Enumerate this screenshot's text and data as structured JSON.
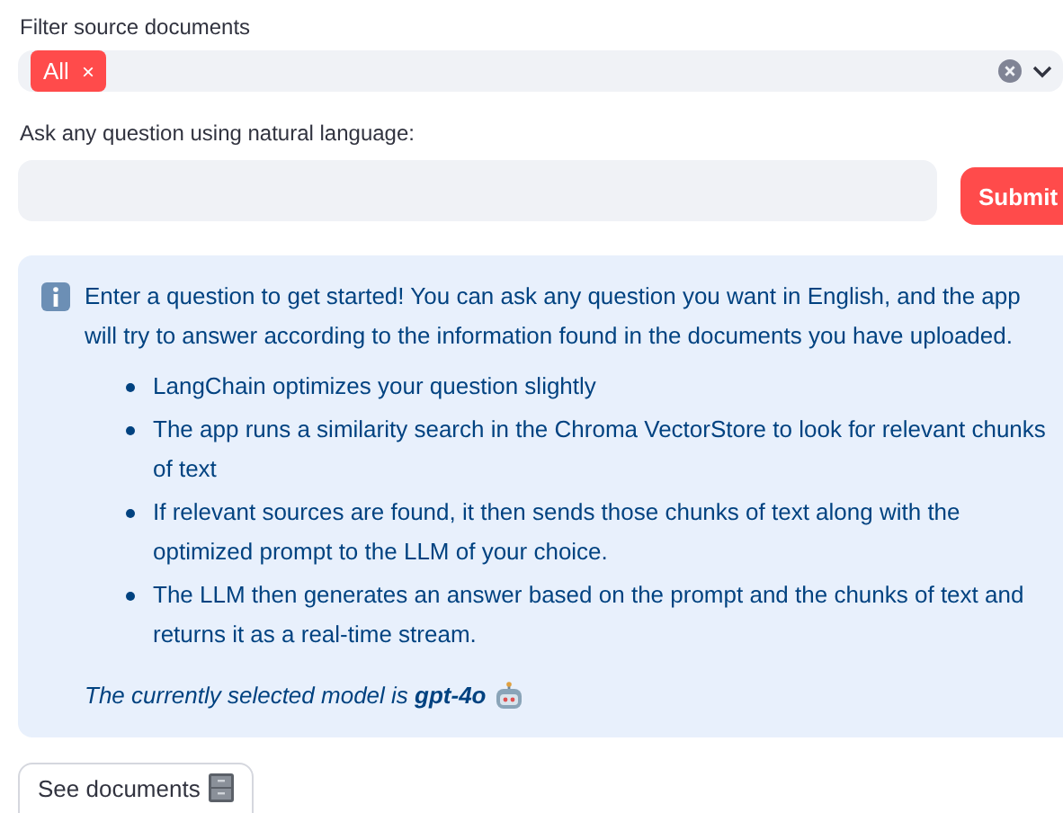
{
  "filter": {
    "label": "Filter source documents",
    "tags": [
      {
        "label": "All",
        "remove": "×"
      }
    ]
  },
  "question": {
    "label": "Ask any question using natural language:",
    "submit": "Submit"
  },
  "info": {
    "intro": "Enter a question to get started! You can ask any question you want in English, and the app will try to answer according to the information found in the documents you have uploaded.",
    "steps": [
      "LangChain optimizes your question slightly",
      "The app runs a similarity search in the Chroma VectorStore to look for relevant chunks of text",
      "If relevant sources are found, it then sends those chunks of text along with the optimized prompt to the LLM of your choice.",
      "The LLM then generates an answer based on the prompt and the chunks of text and returns it as a real-time stream."
    ],
    "model_line": "The currently selected model is **gpt-4o**"
  },
  "see_documents": "See documents"
}
